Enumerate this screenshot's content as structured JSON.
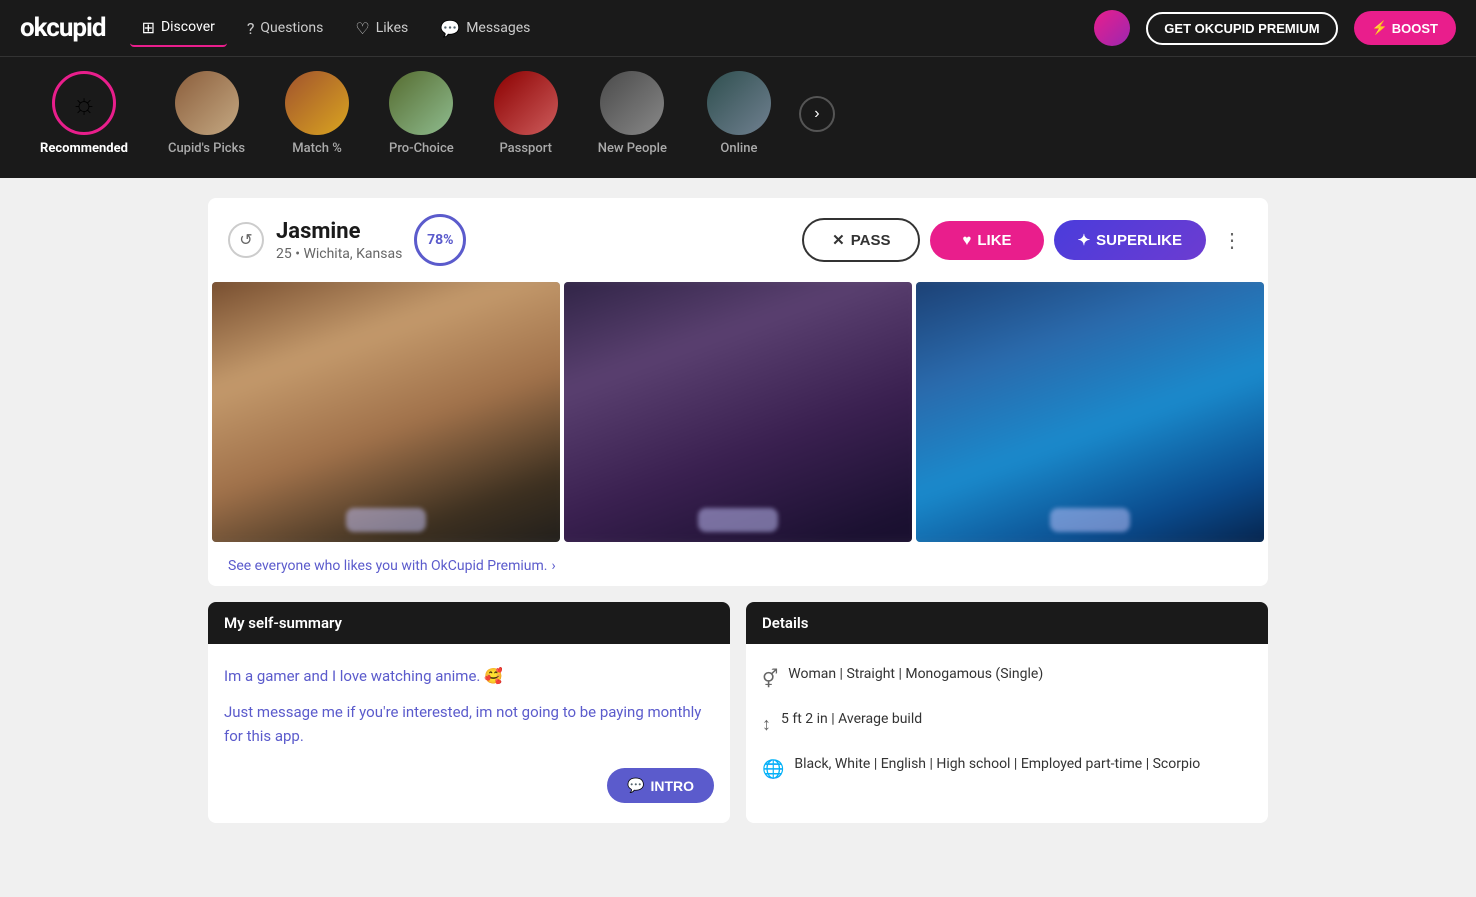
{
  "app": {
    "logo": "okcupid"
  },
  "nav": {
    "items": [
      {
        "id": "discover",
        "label": "Discover",
        "active": true
      },
      {
        "id": "questions",
        "label": "Questions",
        "active": false
      },
      {
        "id": "likes",
        "label": "Likes",
        "active": false
      },
      {
        "id": "messages",
        "label": "Messages",
        "active": false
      }
    ],
    "premium_btn": "GET OKCUPID PREMIUM",
    "boost_btn": "BOOST"
  },
  "categories": [
    {
      "id": "recommended",
      "label": "Recommended",
      "active": true,
      "type": "icon"
    },
    {
      "id": "cupids-picks",
      "label": "Cupid's Picks",
      "active": false,
      "type": "thumb"
    },
    {
      "id": "match",
      "label": "Match %",
      "active": false,
      "type": "thumb"
    },
    {
      "id": "pro-choice",
      "label": "Pro-Choice",
      "active": false,
      "type": "thumb"
    },
    {
      "id": "passport",
      "label": "Passport",
      "active": false,
      "type": "thumb"
    },
    {
      "id": "new-people",
      "label": "New People",
      "active": false,
      "type": "thumb"
    },
    {
      "id": "online",
      "label": "Online",
      "active": false,
      "type": "thumb"
    }
  ],
  "profile": {
    "name": "Jasmine",
    "age": "25",
    "location": "Wichita, Kansas",
    "match_pct": "78%",
    "pass_label": "PASS",
    "like_label": "LIKE",
    "superlike_label": "SUPERLIKE",
    "premium_link": "See everyone who likes you with OkCupid Premium.",
    "self_summary_header": "My self-summary",
    "self_summary_line1": "Im a gamer and I love watching anime. 🥰",
    "self_summary_line2": "Just message me if you're interested, im not going to be paying monthly for this app.",
    "intro_label": "INTRO",
    "details_header": "Details",
    "detail1": "Woman | Straight | Monogamous (Single)",
    "detail2": "5 ft 2 in | Average build",
    "detail3": "Black, White | English | High school | Employed part-time | Scorpio"
  }
}
